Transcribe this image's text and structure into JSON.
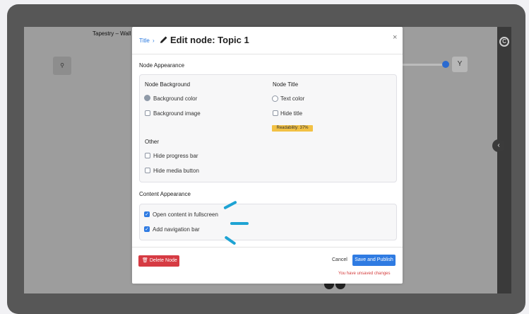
{
  "background": {
    "app_title": "Tapestry – Wall"
  },
  "icons": {
    "search": "search-icon",
    "close": "close-icon",
    "pencil": "pencil-icon",
    "trash": "trash-icon",
    "chevron": "chevron-left-icon",
    "fork": "fork-icon"
  },
  "modal": {
    "breadcrumb": "Title",
    "breadcrumb_sep": "›",
    "title": "Edit node: Topic 1",
    "close": "×",
    "node_appearance": {
      "heading": "Node Appearance",
      "node_background": {
        "heading": "Node Background",
        "options": [
          "Background color",
          "Background image"
        ]
      },
      "node_title": {
        "heading": "Node Title",
        "options": [
          "Text color",
          "Hide title"
        ],
        "badge": "Readability: 37%"
      },
      "other": {
        "heading": "Other",
        "options": [
          "Hide progress bar",
          "Hide media button"
        ]
      }
    },
    "content_appearance": {
      "heading": "Content Appearance",
      "options": [
        {
          "label": "Open content in fullscreen",
          "checked": true
        },
        {
          "label": "Add navigation bar",
          "checked": true
        }
      ]
    },
    "footer": {
      "delete": "Delete Node",
      "cancel": "Cancel",
      "save": "Save and Publish",
      "unsaved": "You have unsaved changes"
    }
  },
  "colors": {
    "primary": "#2f7be2",
    "danger": "#d63b43",
    "warning": "#f2c144",
    "annotation": "#1ea3d3"
  }
}
